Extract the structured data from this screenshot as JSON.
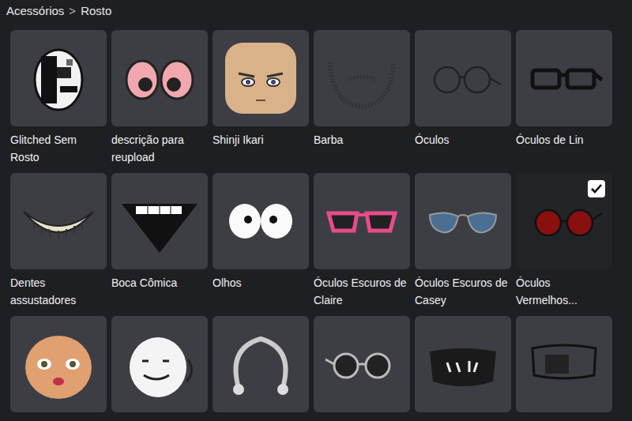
{
  "breadcrumb": {
    "items": [
      "Acessórios",
      "Rosto"
    ],
    "separator": ">"
  },
  "items": [
    {
      "name": "Glitched Sem Rosto",
      "kind": "glitch",
      "selected": false
    },
    {
      "name": "descrição para reupload",
      "kind": "pink-eyes",
      "selected": false
    },
    {
      "name": "Shinji Ikari",
      "kind": "head",
      "selected": false
    },
    {
      "name": "Barba",
      "kind": "beard",
      "selected": false
    },
    {
      "name": "Óculos",
      "kind": "round-glasses",
      "selected": false
    },
    {
      "name": "Óculos de Lin",
      "kind": "square-glasses",
      "selected": false
    },
    {
      "name": "Dentes assustadores",
      "kind": "teeth",
      "selected": false
    },
    {
      "name": "Boca Cômica",
      "kind": "mouth",
      "selected": false
    },
    {
      "name": "Olhos",
      "kind": "white-eyes",
      "selected": false
    },
    {
      "name": "Óculos Escuros de Claire",
      "kind": "pink-sunglasses",
      "selected": false
    },
    {
      "name": "Óculos Escuros de Casey",
      "kind": "aviators",
      "selected": false
    },
    {
      "name": "Óculos Vermelhos...",
      "kind": "red-glasses",
      "selected": true
    },
    {
      "name": "",
      "kind": "orange-head",
      "selected": false
    },
    {
      "name": "",
      "kind": "white-mask",
      "selected": false
    },
    {
      "name": "",
      "kind": "piercing",
      "selected": false
    },
    {
      "name": "",
      "kind": "dark-sunglasses",
      "selected": false
    },
    {
      "name": "",
      "kind": "black-mask",
      "selected": false
    },
    {
      "name": "",
      "kind": "band-mask",
      "selected": false
    }
  ]
}
